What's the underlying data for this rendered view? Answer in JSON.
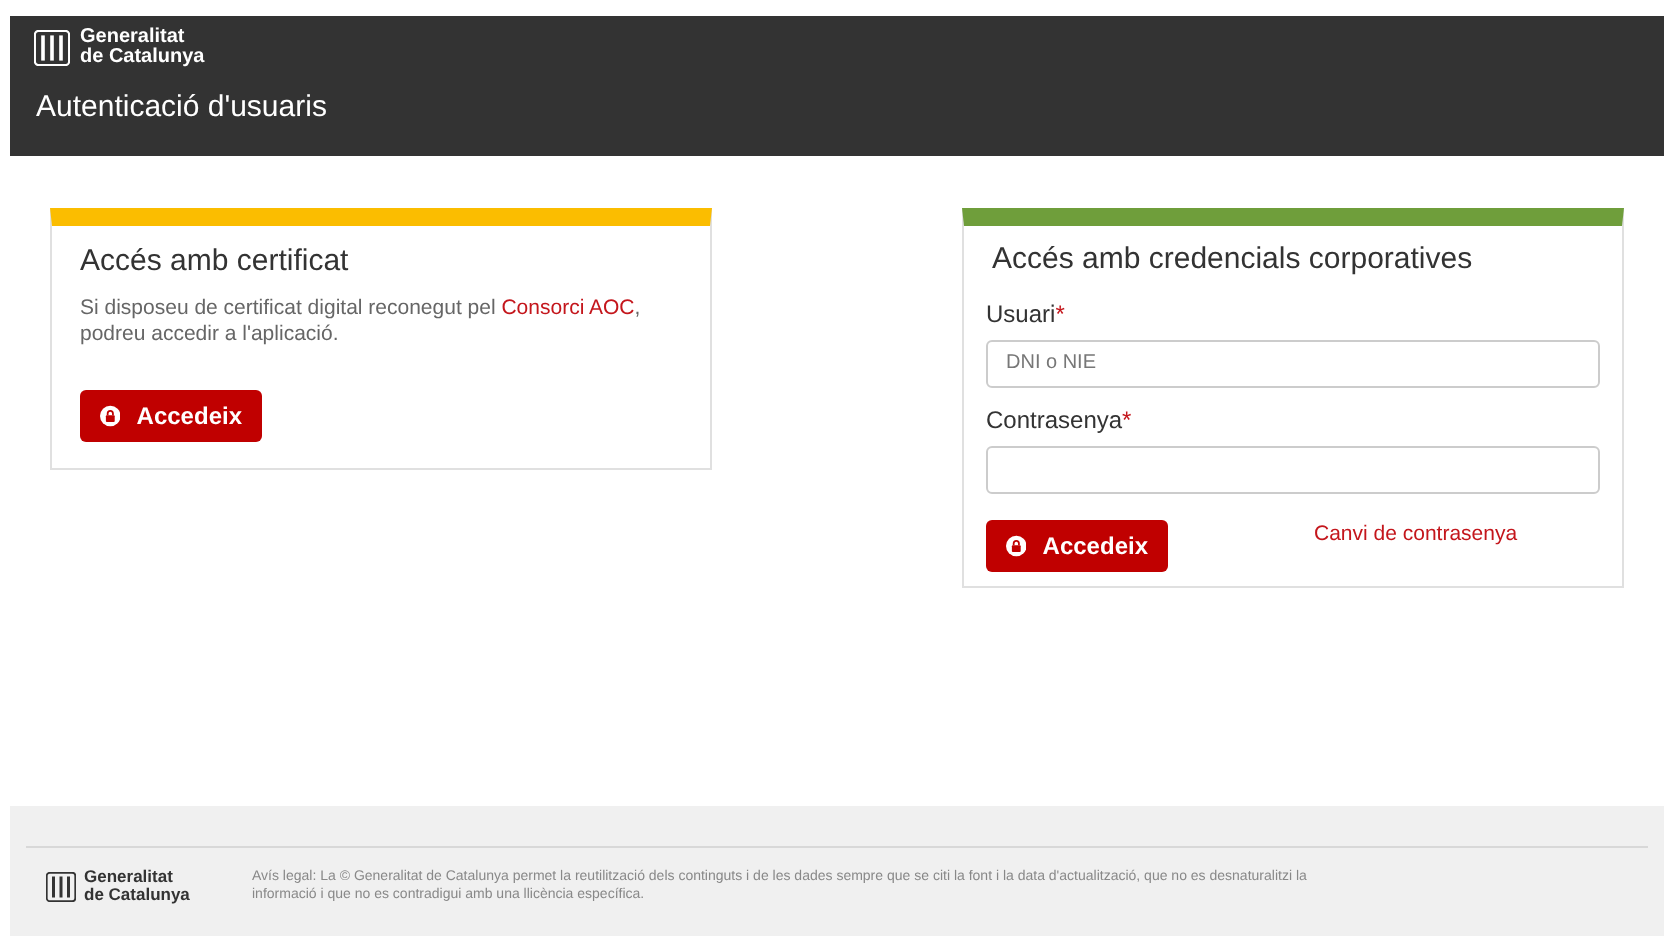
{
  "header": {
    "logo_line_1": "Generalitat",
    "logo_line_2": "de Catalunya",
    "title": "Autenticació d'usuaris"
  },
  "certificate_panel": {
    "title": "Accés amb certificat",
    "text_before": "Si disposeu de certificat digital reconegut pel",
    "link": "Consorci AOC",
    "text_after": ", podreu accedir a l'aplicació.",
    "button": "Accedeix"
  },
  "credentials_panel": {
    "title": "Accés amb credencials corporatives",
    "fields": [
      {
        "label": "Usuari",
        "required_mark": "*",
        "placeholder": "DNI o NIE"
      },
      {
        "label": "Contrasenya",
        "required_mark": "*"
      }
    ],
    "button": "Accedeix",
    "link": "Canvi de contrasenya"
  },
  "footer": {
    "logo_line_1": "Generalitat",
    "logo_line_2": "de Catalunya",
    "legal_text": "Avís legal: La © Generalitat de Catalunya permet la reutilització dels continguts i de les dades sempre que se citi la font i la data d'actualització, que no es desnaturalitzi la informació i que no es contradigui amb una llicència específica."
  }
}
